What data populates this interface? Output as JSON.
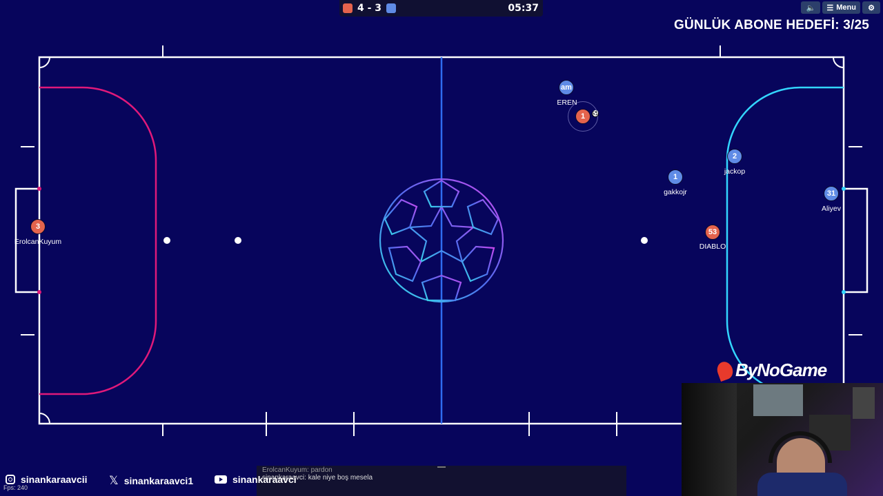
{
  "scoreboard": {
    "red_color": "#e4634d",
    "blue_color": "#5f8be6",
    "score_text": "4 - 3",
    "timer": "05:37"
  },
  "top_buttons": {
    "sound_icon": "speaker-icon",
    "menu_label": "Menu",
    "settings_icon": "gear-icon"
  },
  "overlay": {
    "goal_text": "GÜNLÜK ABONE HEDEFİ: 3/25",
    "brand": "ByNoGame"
  },
  "players": [
    {
      "team": "blue",
      "number": "am",
      "name": "EREN"
    },
    {
      "team": "red",
      "number": "1",
      "name": ""
    },
    {
      "team": "blue",
      "number": "2",
      "name": "jackop"
    },
    {
      "team": "blue",
      "number": "1",
      "name": "gakkojr"
    },
    {
      "team": "blue",
      "number": "31",
      "name": "Aliyev"
    },
    {
      "team": "red",
      "number": "53",
      "name": "DIABLO"
    },
    {
      "team": "red",
      "number": "3",
      "name": "ErolcanKuyum"
    }
  ],
  "chat": {
    "line1": "ErolcanKuyum: pardon",
    "line2": "sinankaraavci: kale niye boş mesela"
  },
  "socials": [
    {
      "icon": "instagram-icon",
      "handle": "sinankaraavcii"
    },
    {
      "icon": "x-icon",
      "handle": "sinankaraavci1"
    },
    {
      "icon": "youtube-icon",
      "handle": "sinankaraavci"
    }
  ],
  "fps": "Fps: 240",
  "colors": {
    "background": "#07055c",
    "left_area": "#e0197a",
    "right_area": "#33d6ff",
    "center_line": "#2f6cf0"
  }
}
